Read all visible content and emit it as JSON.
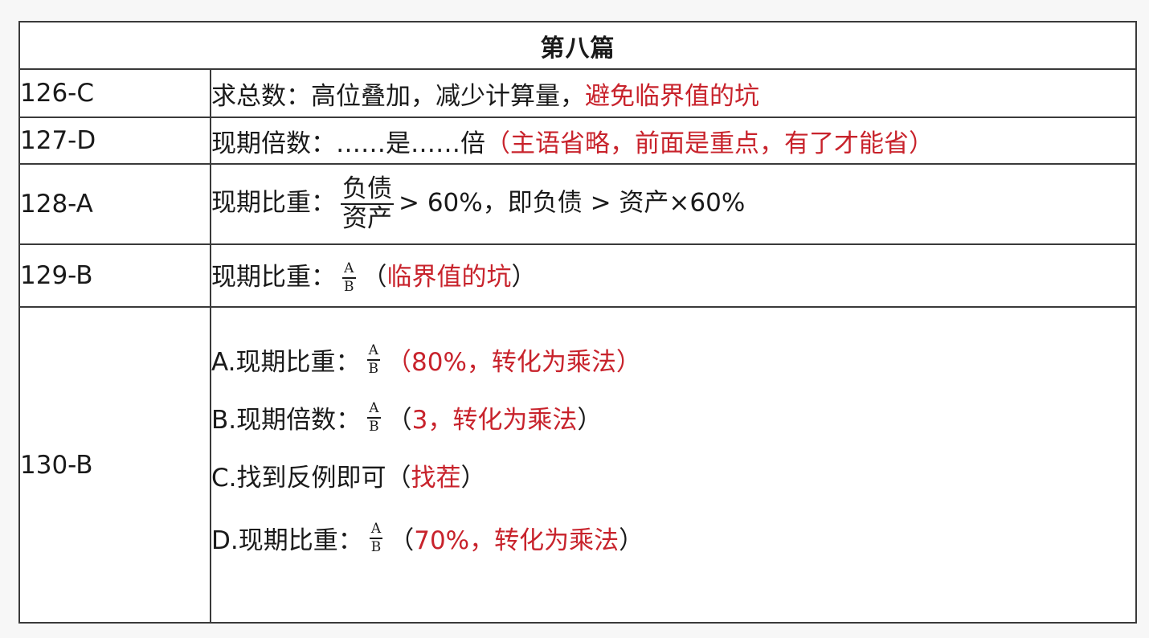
{
  "title": "第八篇",
  "rows": [
    {
      "id": "126-C",
      "prefix": "求总数：高位叠加，减少计算量，",
      "red": "避免临界值的坑"
    },
    {
      "id": "127-D",
      "prefix": "现期倍数：……是……倍",
      "red": "（主语省略，前面是重点，有了才能省）"
    },
    {
      "id": "128-A",
      "prefix": "现期比重：",
      "frac_num": "负债",
      "frac_den": "资产",
      "suffix": "> 60%，即负债 > 资产×60%"
    },
    {
      "id": "129-B",
      "prefix": "现期比重：",
      "frac_num": "A",
      "frac_den": "B",
      "red": "临界值的坑",
      "open_paren": "（",
      "close_paren": "）"
    },
    {
      "id": "130-B",
      "items": [
        {
          "label": "A.现期比重：",
          "frac_num": "A",
          "frac_den": "B",
          "open_paren": "（",
          "red": "80%，转化为乘法",
          "close_paren": "）"
        },
        {
          "label": "B.现期倍数：",
          "frac_num": "A",
          "frac_den": "B",
          "open_paren": "（",
          "red": "3，转化为乘法",
          "close_paren": "）"
        },
        {
          "label": "C.找到反例即可",
          "open_paren": "（",
          "red": "找茬",
          "close_paren": "）"
        },
        {
          "label": "D.现期比重：",
          "frac_num": "A",
          "frac_den": "B",
          "open_paren": "（",
          "red": "70%，转化为乘法",
          "close_paren": "）"
        }
      ]
    }
  ],
  "colors": {
    "highlight": "#c8232c",
    "text": "#1a1a1a",
    "border": "#3a3a3a"
  }
}
